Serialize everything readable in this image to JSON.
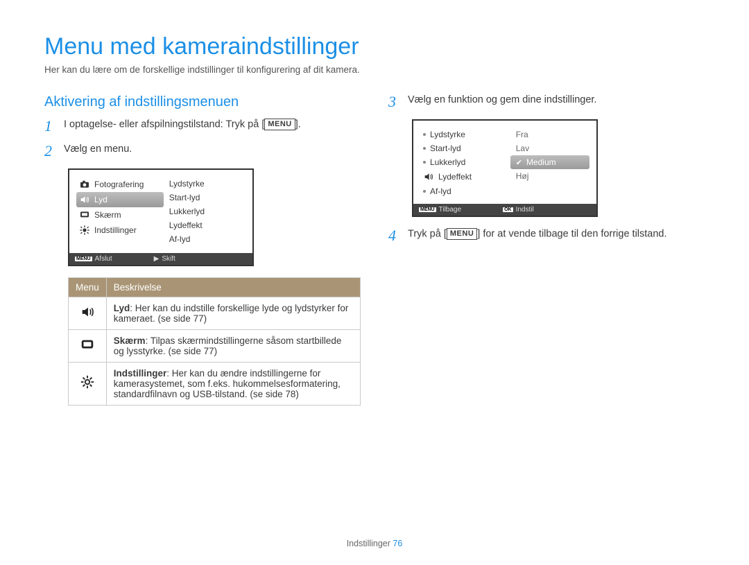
{
  "title": "Menu med kameraindstillinger",
  "subtitle": "Her kan du lære om de forskellige indstillinger til konfigurering af dit kamera.",
  "left": {
    "heading": "Aktivering af indstillingsmenuen",
    "step1_pre": "I optagelse- eller afspilningstilstand: Tryk på [",
    "step1_menu": "MENU",
    "step1_post": "].",
    "step2": "Vælg en menu.",
    "cam1": {
      "left_items": [
        "Fotografering",
        "Lyd",
        "Skærm",
        "Indstillinger"
      ],
      "right_items": [
        "Lydstyrke",
        "Start-lyd",
        "Lukkerlyd",
        "Lydeffekt",
        "Af-lyd"
      ],
      "footer_left": "Afslut",
      "footer_menu": "MENU",
      "footer_right": "Skift"
    },
    "table": {
      "head_menu": "Menu",
      "head_desc": "Beskrivelse",
      "rows": [
        {
          "icon": "sound",
          "bold": "Lyd",
          "rest": ": Her kan du indstille forskellige lyde og lydstyrker for kameraet. (se side 77)"
        },
        {
          "icon": "screen",
          "bold": "Skærm",
          "rest": ": Tilpas skærmindstillingerne såsom startbillede og lysstyrke. (se side 77)"
        },
        {
          "icon": "gear",
          "bold": "Indstillinger",
          "rest": ": Her kan du ændre indstillingerne for kamerasystemet, som f.eks. hukommelsesformatering, standardfilnavn og USB-tilstand. (se side 78)"
        }
      ]
    }
  },
  "right": {
    "step3": "Vælg en funktion og gem dine indstillinger.",
    "cam2": {
      "left_items": [
        "Lydstyrke",
        "Start-lyd",
        "Lukkerlyd",
        "Lydeffekt",
        "Af-lyd"
      ],
      "options": [
        "Fra",
        "Lav",
        "Medium",
        "Høj"
      ],
      "selected_index": 2,
      "footer_left": "Tilbage",
      "footer_menu": "MENU",
      "footer_ok": "OK",
      "footer_right": "Indstil"
    },
    "step4_pre": "Tryk på [",
    "step4_menu": "MENU",
    "step4_post": "] for at vende tilbage til den forrige tilstand."
  },
  "footer_label": "Indstillinger",
  "footer_page": "76"
}
